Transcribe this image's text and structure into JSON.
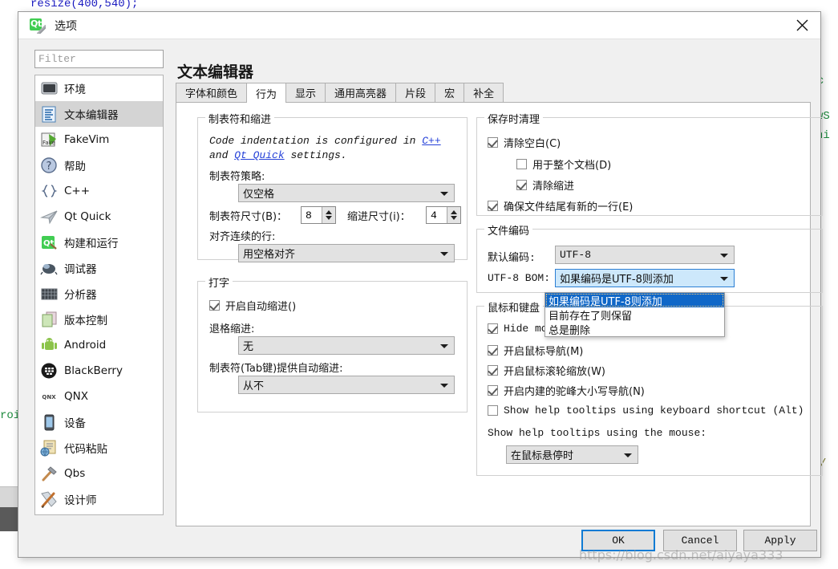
{
  "background": {
    "top_code": "resize(400,540);",
    "left_code": "roid",
    "right_1": "c",
    "right_2": "wS",
    "right_3": "ni",
    "right_4": "/"
  },
  "dialog": {
    "title": "选项",
    "logo_text": "Qt",
    "close_icon": "close-icon"
  },
  "sidebar": {
    "filter_placeholder": "Filter",
    "filter_value": "",
    "items": [
      {
        "label": "环境",
        "icon": "monitor-icon",
        "selected": false
      },
      {
        "label": "文本编辑器",
        "icon": "text-editor-icon",
        "selected": true
      },
      {
        "label": "FakeVim",
        "icon": "fakevim-icon",
        "selected": false
      },
      {
        "label": "帮助",
        "icon": "question-mark-icon",
        "selected": false
      },
      {
        "label": "C++",
        "icon": "braces-icon",
        "selected": false
      },
      {
        "label": "Qt Quick",
        "icon": "paper-plane-icon",
        "selected": false
      },
      {
        "label": "构建和运行",
        "icon": "qt-build-icon",
        "selected": false
      },
      {
        "label": "调试器",
        "icon": "bug-icon",
        "selected": false
      },
      {
        "label": "分析器",
        "icon": "analyzer-grid-icon",
        "selected": false
      },
      {
        "label": "版本控制",
        "icon": "documents-icon",
        "selected": false
      },
      {
        "label": "Android",
        "icon": "android-robot-icon",
        "selected": false
      },
      {
        "label": "BlackBerry",
        "icon": "blackberry-icon",
        "selected": false
      },
      {
        "label": "QNX",
        "icon": "qnx-icon",
        "selected": false
      },
      {
        "label": "设备",
        "icon": "device-tablet-icon",
        "selected": false
      },
      {
        "label": "代码粘贴",
        "icon": "clipboard-globe-icon",
        "selected": false
      },
      {
        "label": "Qbs",
        "icon": "hammer-icon",
        "selected": false
      },
      {
        "label": "设计师",
        "icon": "pen-ruler-icon",
        "selected": false
      }
    ]
  },
  "page": {
    "title": "文本编辑器",
    "tabs": [
      {
        "label": "字体和颜色",
        "active": false
      },
      {
        "label": "行为",
        "active": true
      },
      {
        "label": "显示",
        "active": false
      },
      {
        "label": "通用高亮器",
        "active": false
      },
      {
        "label": "片段",
        "active": false
      },
      {
        "label": "宏",
        "active": false
      },
      {
        "label": "补全",
        "active": false
      }
    ]
  },
  "tabs_indent": {
    "group_title": "制表符和缩进",
    "info_prefix": "Code indentation is configured in ",
    "info_link1": "C++",
    "info_mid": "\nand ",
    "info_link2": "Qt Quick",
    "info_suffix": " settings.",
    "tab_policy_label": "制表符策略:",
    "tab_policy_value": "仅空格",
    "tab_size_label": "制表符尺寸(B)：",
    "tab_size_value": "8",
    "indent_size_label": "缩进尺寸(i)：",
    "indent_size_value": "4",
    "align_label": "对齐连续的行:",
    "align_value": "用空格对齐"
  },
  "typing": {
    "group_title": "打字",
    "auto_indent_label": "开启自动缩进()",
    "auto_indent_checked": true,
    "backspace_label": "退格缩进:",
    "backspace_value": "无",
    "tab_key_label": "制表符(Tab键)提供自动缩进:",
    "tab_key_value": "从不"
  },
  "cleanup": {
    "group_title": "保存时清理",
    "clean_whitespace_label": "清除空白(C)",
    "clean_whitespace_checked": true,
    "whole_doc_label": "用于整个文档(D)",
    "whole_doc_checked": false,
    "clean_indent_label": "清除缩进",
    "clean_indent_checked": true,
    "ensure_newline_label": "确保文件结尾有新的一行(E)",
    "ensure_newline_checked": true
  },
  "encoding": {
    "group_title": "文件编码",
    "default_label": "默认编码:",
    "default_value": "UTF-8",
    "bom_label": "UTF-8 BOM:",
    "bom_value": "如果编码是UTF-8则添加",
    "bom_options": [
      {
        "label": "如果编码是UTF-8则添加",
        "highlighted": true
      },
      {
        "label": "目前存在了则保留",
        "highlighted": false
      },
      {
        "label": "总是删除",
        "highlighted": false
      }
    ]
  },
  "mouse_keyboard": {
    "group_title": "鼠标和键盘",
    "items": [
      {
        "label": "Hide mouse cursor while typing",
        "checked": true,
        "mono": true
      },
      {
        "label": "开启鼠标导航(M)",
        "checked": true,
        "mono": false
      },
      {
        "label": "开启鼠标滚轮缩放(W)",
        "checked": true,
        "mono": false
      },
      {
        "label": "开启内建的驼峰大小写导航(N)",
        "checked": true,
        "mono": false
      },
      {
        "label": "Show help tooltips using keyboard shortcut (Alt)",
        "checked": false,
        "mono": true
      }
    ],
    "tooltip_label": "Show help tooltips using the mouse:",
    "tooltip_value": "在鼠标悬停时"
  },
  "buttons": {
    "ok": "OK",
    "cancel": "Cancel",
    "apply": "Apply"
  },
  "watermark": "https://blog.csdn.net/aiyaya333",
  "colors": {
    "accent": "#0f7bd4",
    "selection": "#0f67c8",
    "qt_green": "#41cd52",
    "link": "#2440d8"
  }
}
